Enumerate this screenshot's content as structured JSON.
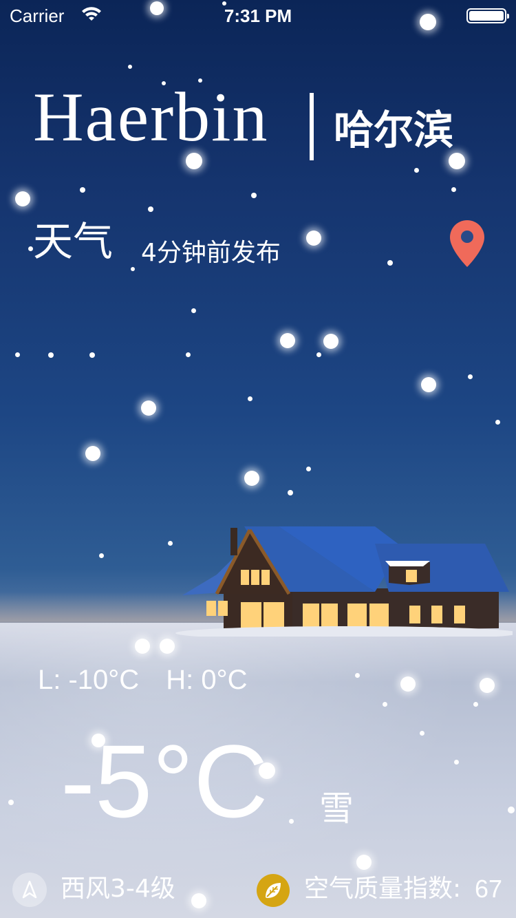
{
  "status_bar": {
    "carrier": "Carrier",
    "time": "7:31 PM"
  },
  "header": {
    "city_en": "Haerbin",
    "city_cn": "哈尔滨"
  },
  "info": {
    "weather_label": "天气",
    "published": "4分钟前发布",
    "location_icon": "map-pin-icon"
  },
  "temps": {
    "low": "L: -10°C",
    "high": "H: 0°C",
    "current": "-5°C",
    "condition": "雪"
  },
  "bottom": {
    "wind": "西风3-4级",
    "wind_icon": "navigation-arrow-icon",
    "aqi_label": "空气质量指数:",
    "aqi_value": "67",
    "aqi_icon": "leaf-icon"
  },
  "colors": {
    "pin": "#f06a5a",
    "aqi_badge": "#d5a513",
    "sky_top": "#0b2557"
  }
}
